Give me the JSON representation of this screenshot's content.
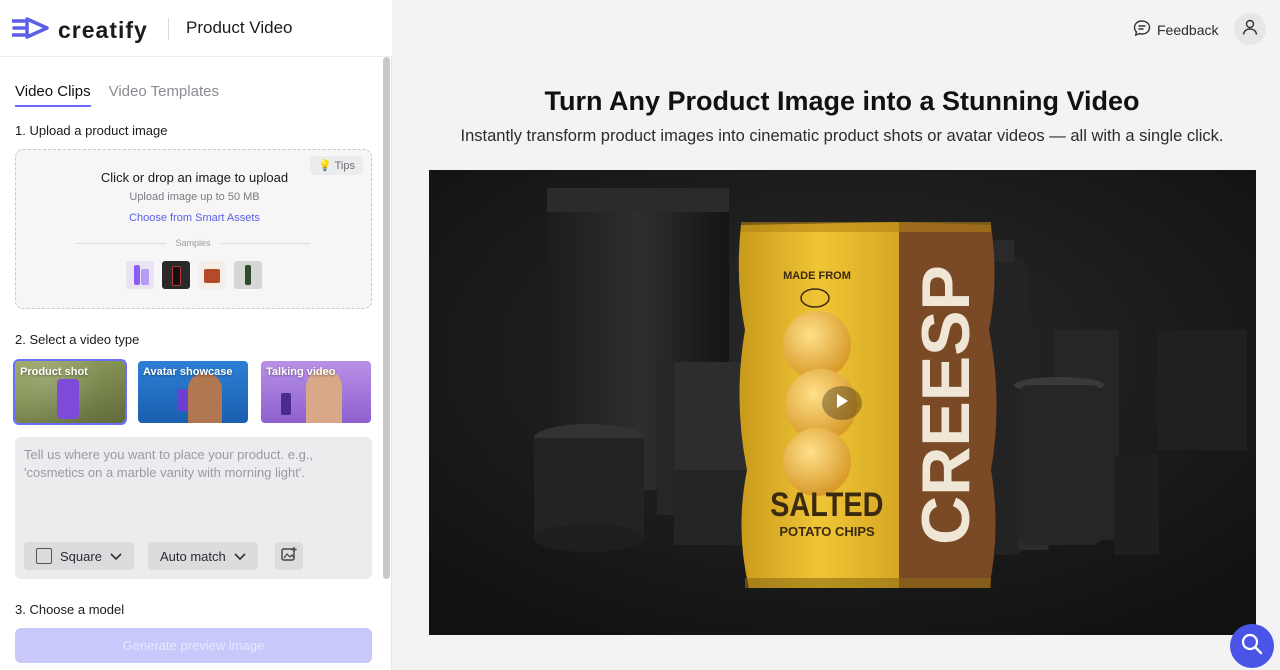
{
  "app": {
    "brand": "creatify",
    "page_title": "Product Video"
  },
  "tabs": [
    {
      "label": "Video Clips",
      "active": true
    },
    {
      "label": "Video Templates",
      "active": false
    }
  ],
  "step1": {
    "label": "1. Upload a product image",
    "drop_title": "Click or drop an image to upload",
    "drop_sub": "Upload image up to 50 MB",
    "smart_assets_link": "Choose from Smart Assets",
    "samples_label": "Samples",
    "tips_label": "💡 Tips",
    "sample_count": 4
  },
  "step2": {
    "label": "2. Select a video type",
    "types": [
      {
        "label": "Product shot",
        "selected": true
      },
      {
        "label": "Avatar showcase",
        "selected": false
      },
      {
        "label": "Talking video",
        "selected": false
      }
    ],
    "prompt_placeholder": "Tell us where you want to place your product. e.g., 'cosmetics on a marble vanity with morning light'.",
    "aspect_value": "Square",
    "match_value": "Auto match"
  },
  "step3": {
    "label": "3. Choose a model"
  },
  "generate_label": "Generate preview image",
  "header": {
    "feedback_label": "Feedback"
  },
  "hero": {
    "headline": "Turn Any Product Image into a Stunning Video",
    "subline": "Instantly transform product images into cinematic product shots or avatar videos — all with a single click."
  },
  "video": {
    "bag_top": "MADE FROM",
    "bag_brand": "CREESP",
    "bag_title": "SALTED",
    "bag_sub": "POTATO CHIPS"
  },
  "colors": {
    "accent": "#6c6cff",
    "fab": "#4a55e8",
    "bag_yellow": "#e9b92a",
    "bag_brown": "#7a4a26"
  }
}
